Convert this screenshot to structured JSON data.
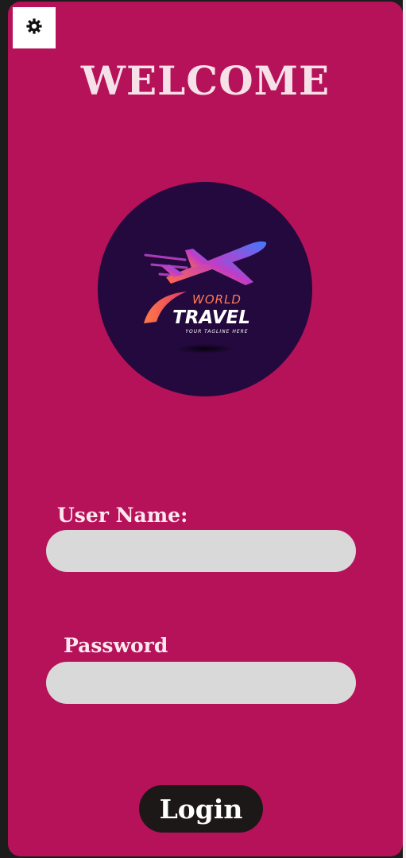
{
  "header": {
    "settings_icon": "gear-icon",
    "title": "WELCOME"
  },
  "logo": {
    "word1": "WORLD",
    "word2": "TRAVEL",
    "tagline": "YOUR TAGLINE HERE"
  },
  "form": {
    "username_label": "User Name:",
    "username_value": "",
    "password_label": "Password",
    "password_value": "",
    "login_label": "Login"
  },
  "colors": {
    "background": "#b6125a",
    "title": "#f7e1e8",
    "logo_circle": "#24093f",
    "input_fill": "#d9d9d9",
    "button": "#1d1818"
  }
}
